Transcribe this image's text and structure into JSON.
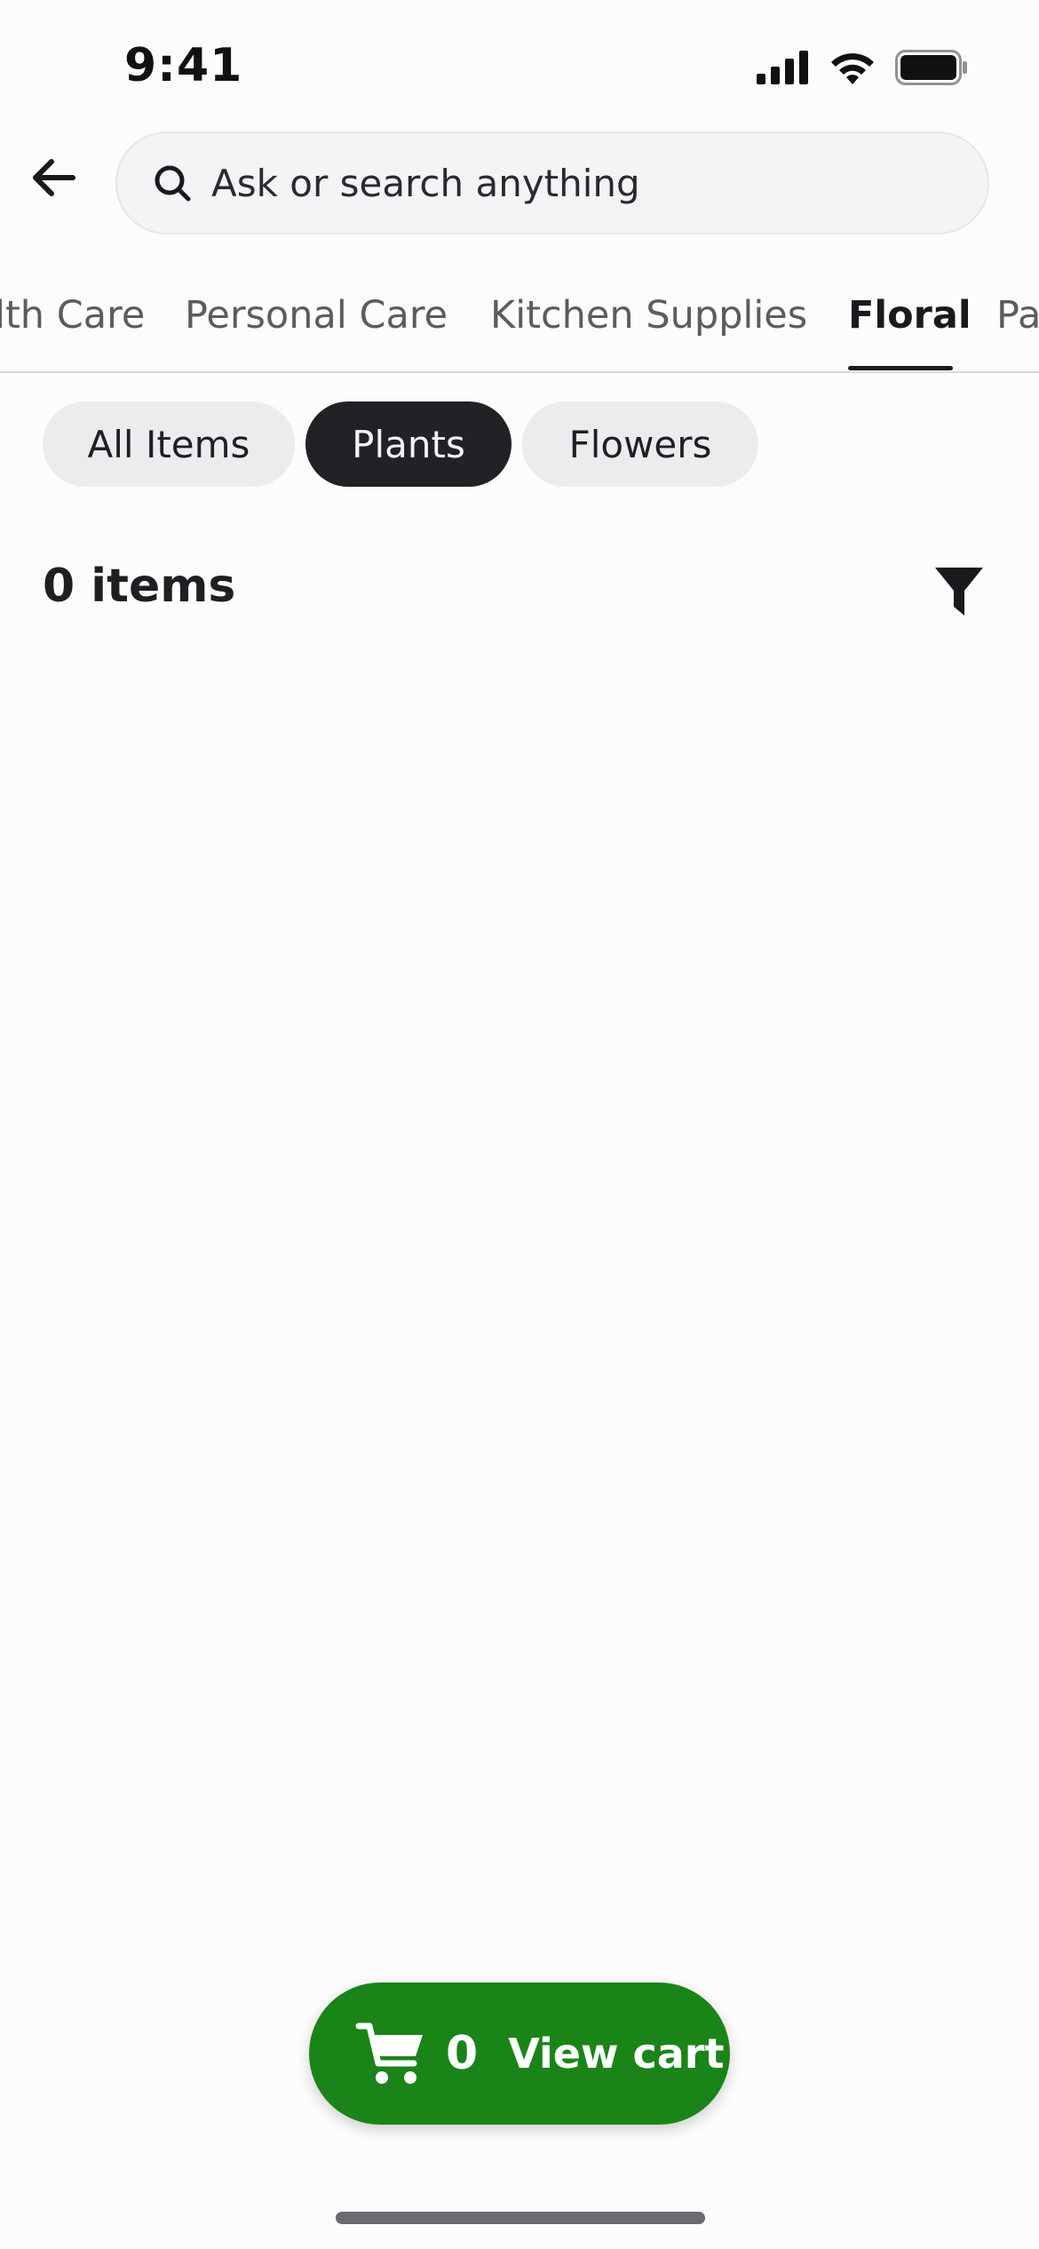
{
  "status_bar": {
    "time": "9:41",
    "icons": [
      "cellular-signal-icon",
      "wifi-icon",
      "battery-icon"
    ]
  },
  "header": {
    "back_icon": "arrow-left-icon",
    "search": {
      "icon": "search-icon",
      "placeholder": "Ask or search anything"
    }
  },
  "tabs": [
    {
      "label": "lth Care",
      "active": false
    },
    {
      "label": "Personal Care",
      "active": false
    },
    {
      "label": "Kitchen Supplies",
      "active": false
    },
    {
      "label": "Floral",
      "active": true
    },
    {
      "label": "Pa",
      "active": false
    }
  ],
  "chips": [
    {
      "label": "All Items",
      "selected": false
    },
    {
      "label": "Plants",
      "selected": true
    },
    {
      "label": "Flowers",
      "selected": false
    }
  ],
  "results": {
    "count_label": "0 items",
    "filter_icon": "funnel-icon"
  },
  "cart": {
    "icon": "shopping-cart-icon",
    "count": "0",
    "label": "View cart"
  },
  "colors": {
    "accent_green": "#1a8418",
    "chip_selected_bg": "#222226",
    "chip_bg": "#ececee",
    "search_bg": "#f4f4f6"
  }
}
